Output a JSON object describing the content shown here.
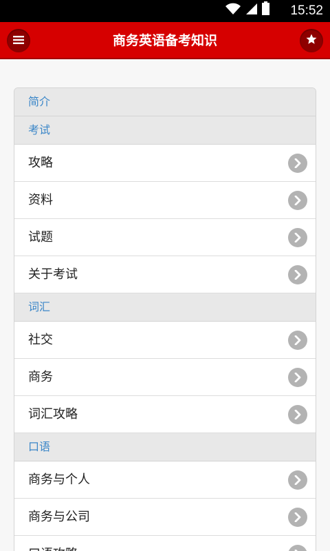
{
  "status_bar": {
    "time": "15:52",
    "icons": [
      "wifi-icon",
      "signal-icon",
      "battery-icon"
    ]
  },
  "app_bar": {
    "title": "商务英语备考知识",
    "left_icon": "menu-icon",
    "right_icon": "star-icon"
  },
  "colors": {
    "app_bar": "#d60000",
    "app_bar_button": "#8e0000",
    "divider_text": "#3a86c8",
    "divider_bg": "#e8e8e8",
    "arrow_button": "#b3b3b3"
  },
  "list": [
    {
      "type": "divider",
      "label": "简介"
    },
    {
      "type": "divider",
      "label": "考试"
    },
    {
      "type": "item",
      "label": "攻略"
    },
    {
      "type": "item",
      "label": "资料"
    },
    {
      "type": "item",
      "label": "试题"
    },
    {
      "type": "item",
      "label": "关于考试"
    },
    {
      "type": "divider",
      "label": "词汇"
    },
    {
      "type": "item",
      "label": "社交"
    },
    {
      "type": "item",
      "label": "商务"
    },
    {
      "type": "item",
      "label": "词汇攻略"
    },
    {
      "type": "divider",
      "label": "口语"
    },
    {
      "type": "item",
      "label": "商务与个人"
    },
    {
      "type": "item",
      "label": "商务与公司"
    },
    {
      "type": "item",
      "label": "口语攻略"
    }
  ]
}
